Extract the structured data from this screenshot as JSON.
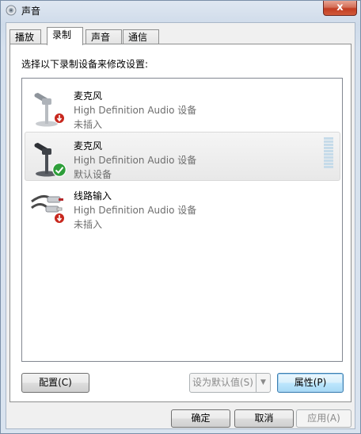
{
  "window": {
    "title": "声音",
    "close_label": "x"
  },
  "tabs": [
    {
      "label": "播放",
      "active": false
    },
    {
      "label": "录制",
      "active": true
    },
    {
      "label": "声音",
      "active": false
    },
    {
      "label": "通信",
      "active": false
    }
  ],
  "panel": {
    "instruction": "选择以下录制设备来修改设置:"
  },
  "devices": [
    {
      "name": "麦克风",
      "description": "High Definition Audio 设备",
      "status": "未插入",
      "icon": "microphone-icon",
      "badge": "unplugged-badge-icon",
      "selected": false
    },
    {
      "name": "麦克风",
      "description": "High Definition Audio 设备",
      "status": "默认设备",
      "icon": "microphone-icon",
      "badge": "default-check-badge-icon",
      "selected": true
    },
    {
      "name": "线路输入",
      "description": "High Definition Audio 设备",
      "status": "未插入",
      "icon": "line-in-cable-icon",
      "badge": "unplugged-badge-icon",
      "selected": false
    }
  ],
  "buttons": {
    "configure": "配置(C)",
    "set_default": "设为默认值(S)",
    "properties": "属性(P)",
    "ok": "确定",
    "cancel": "取消",
    "apply": "应用(A)"
  },
  "colors": {
    "selection_bg": "#e8e8e8",
    "close_button": "#c23d22",
    "default_badge": "#2e9e3a",
    "unplugged_badge": "#c8281e",
    "level_meter": "#c6dbe9"
  }
}
